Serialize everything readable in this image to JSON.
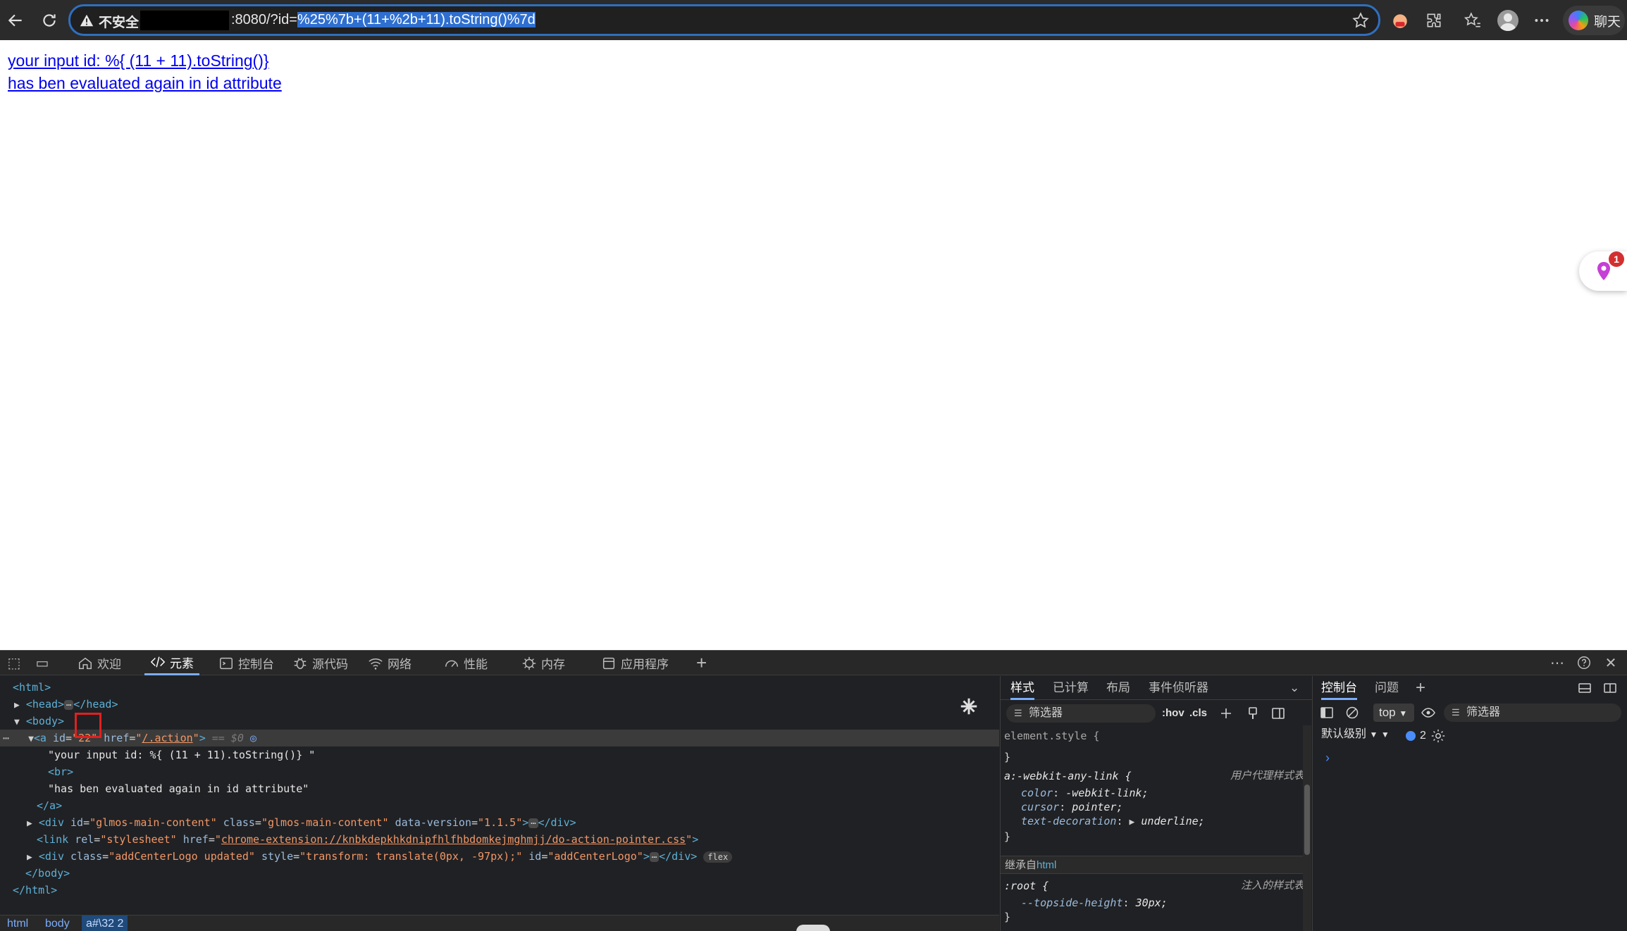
{
  "browser": {
    "security_label": "不安全",
    "url_host": ":8080/?id=",
    "url_query_selected": "%25%7b+(11+%2b+11).toString()%7d",
    "chat_label": "聊天"
  },
  "page": {
    "link_line1": "your input id: %{ (11 + 11).toString()}",
    "link_line2": "has ben evaluated again in id attribute",
    "notification_count": "1"
  },
  "devtools": {
    "tabs": [
      {
        "label": "欢迎",
        "icon": "home-icon"
      },
      {
        "label": "元素",
        "icon": "code-icon",
        "active": true
      },
      {
        "label": "控制台",
        "icon": "console-icon"
      },
      {
        "label": "源代码",
        "icon": "bug-icon"
      },
      {
        "label": "网络",
        "icon": "wifi-icon"
      },
      {
        "label": "性能",
        "icon": "gauge-icon"
      },
      {
        "label": "内存",
        "icon": "memory-icon"
      },
      {
        "label": "应用程序",
        "icon": "app-icon"
      }
    ],
    "elements": {
      "html_open": "<html>",
      "head": "<head>",
      "head_close": "</head>",
      "body_open": "<body>",
      "a_tag": "a",
      "a_id_value": "22",
      "a_href_value": "/.action",
      "eq_dollar": "== $0",
      "text1": "\"your input id: %{ (11 + 11).toString()} \"",
      "br": "<br>",
      "text2": "\"has ben evaluated again in id attribute\"",
      "a_close": "</a>",
      "div_id_value": "glmos-main-content",
      "div_class_value": "glmos-main-content",
      "div_version_value": "1.1.5",
      "link_rel_value": "stylesheet",
      "link_href_value": "chrome-extension://knbkdepkhkdnipfhlfhbdomkejmghmjj/do-action-pointer.css",
      "div2_class_value": "addCenterLogo updated",
      "div2_style_value": "transform: translate(0px, -97px);",
      "div2_id_value": "addCenterLogo",
      "flex_badge": "flex",
      "body_close": "</body>",
      "html_close": "</html>"
    },
    "breadcrumbs": [
      "html",
      "body",
      "a#\\32 2"
    ],
    "styles": {
      "tabs": [
        "样式",
        "已计算",
        "布局",
        "事件侦听器"
      ],
      "filter_placeholder": "筛选器",
      "hov": ":hov",
      "cls": ".cls",
      "element_style": "element.style {",
      "close_brace": "}",
      "rule1_selector": "a:-webkit-any-link {",
      "rule1_origin": "用户代理样式表",
      "rule1_props": [
        {
          "name": "color",
          "value": "-webkit-link;"
        },
        {
          "name": "cursor",
          "value": "pointer;"
        },
        {
          "name": "text-decoration",
          "value": "underline;"
        }
      ],
      "inherited_prefix": "继承自",
      "inherited_tag": "html",
      "rule2_selector": ":root {",
      "rule2_origin": "注入的样式表",
      "rule2_prop_name": "--topside-height",
      "rule2_prop_value": "30px;"
    },
    "console": {
      "tabs": [
        "控制台",
        "问题"
      ],
      "context": "top",
      "filter_placeholder": "筛选器",
      "levels_label": "默认级别",
      "message_count": "2",
      "prompt": "›"
    }
  }
}
